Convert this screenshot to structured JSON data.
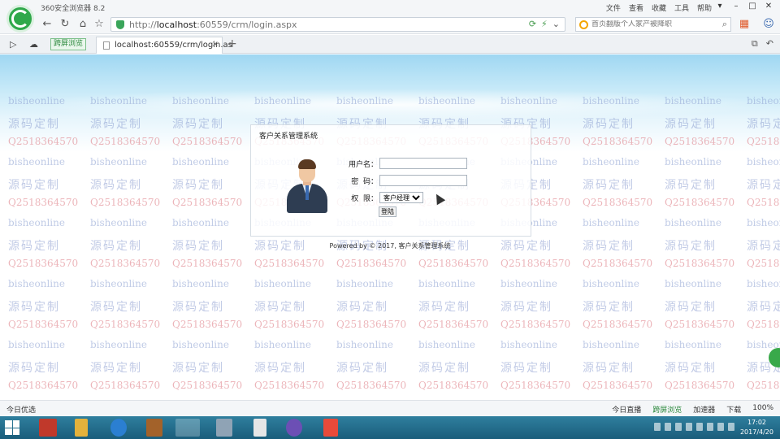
{
  "browser": {
    "app_name": "360安全浏览器 8.2",
    "menu": [
      "文件",
      "查看",
      "收藏",
      "工具",
      "帮助"
    ],
    "address": {
      "prefix": "http://",
      "host": "localhost",
      "rest": ":60559/crm/login.aspx"
    },
    "search": {
      "placeholder": "首页翻版个人家产被降职"
    },
    "pill_label": "跨屏浏览",
    "tab": {
      "title": "localhost:60559/crm/login.as",
      "close": "×"
    },
    "new_tab": "+"
  },
  "login": {
    "title": "客户关系管理系统",
    "username_label": "用户名：",
    "password_label": "密  码：",
    "role_label": "权  限：",
    "role_options": [
      "客户经理"
    ],
    "role_selected": "客户经理",
    "button_label": "登陆",
    "footer": "Powered by © 2017, 客户关系管理系统"
  },
  "watermark": {
    "qq": "Q2518364570",
    "site": "bisheonline",
    "custom": "源码定制"
  },
  "statusbar": {
    "left": "今日优选",
    "items": [
      "今日直播",
      "跨屏浏览",
      "加速器",
      "下载",
      "100%"
    ]
  },
  "taskbar": {
    "time": "17:02",
    "date": "2017/4/20"
  },
  "colors": {
    "accent_green": "#2fa84a",
    "sky_blue": "#9fd7f2",
    "watermark_red": "#dc7882",
    "watermark_blue": "#8ca0d2",
    "taskbar": "#1a5d7b"
  }
}
